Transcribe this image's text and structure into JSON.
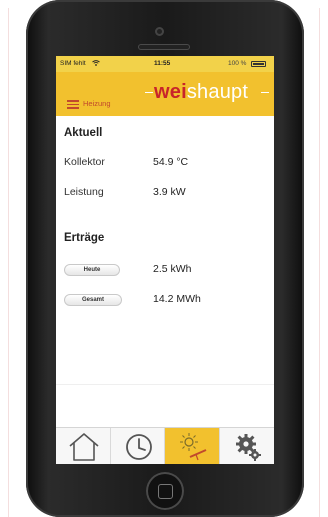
{
  "status_bar": {
    "carrier": "SIM fehlt",
    "time": "11:55",
    "battery": "100 %"
  },
  "header": {
    "menu_label": "Heizung",
    "brand_prefix": "wei",
    "brand_suffix": "shaupt"
  },
  "current": {
    "title": "Aktuell",
    "collector_label": "Kollektor",
    "collector_value": "54.9 °C",
    "power_label": "Leistung",
    "power_value": "3.9 kW"
  },
  "yields": {
    "title": "Erträge",
    "today_button": "Heute",
    "today_value": "2.5 kWh",
    "total_button": "Gesamt",
    "total_value": "14.2 MWh"
  },
  "tabs": [
    {
      "icon": "home-icon",
      "active": false
    },
    {
      "icon": "clock-icon",
      "active": false
    },
    {
      "icon": "solar-collector-icon",
      "active": true
    },
    {
      "icon": "gears-icon",
      "active": false
    }
  ],
  "colors": {
    "accent_yellow": "#f2c12e",
    "brand_red": "#c8242a",
    "menu_red": "#c14a2c"
  }
}
